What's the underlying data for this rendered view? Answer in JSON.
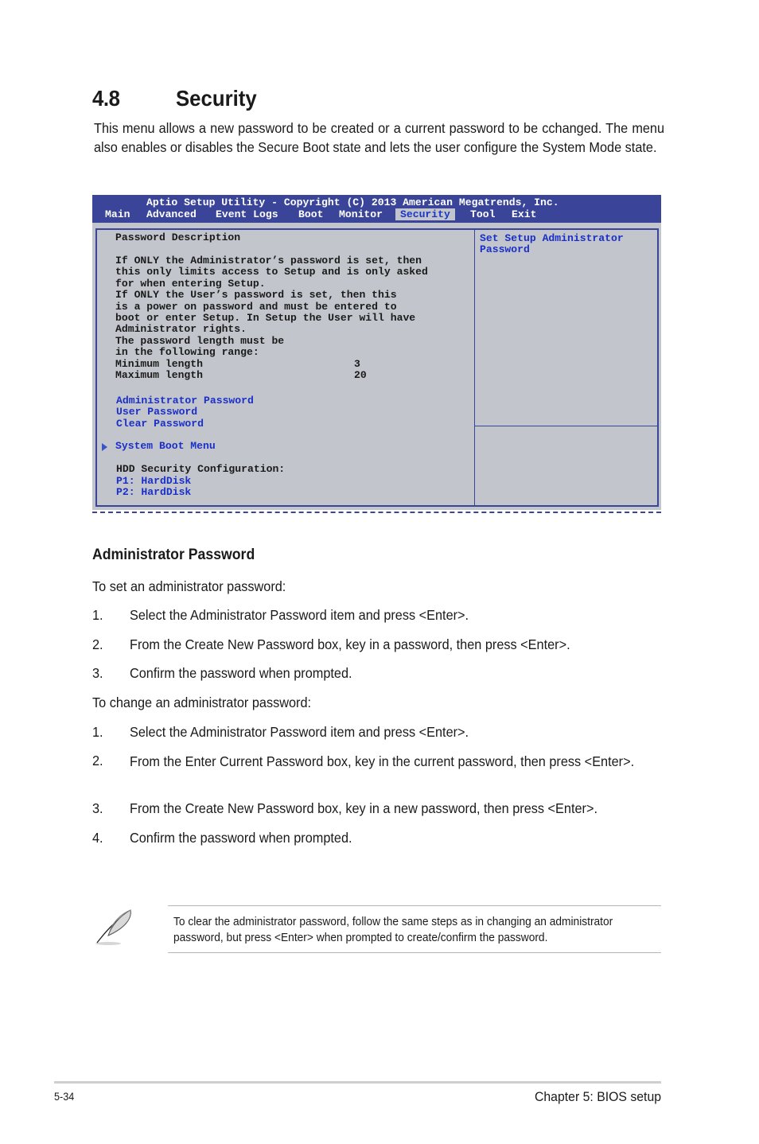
{
  "section": {
    "number": "4.8",
    "title": "Security",
    "intro": "This menu allows a new password to be created or a current password to be cchanged. The menu also enables or disables the Secure Boot state and lets the user configure the System Mode state."
  },
  "bios": {
    "title": "Aptio Setup Utility - Copyright (C) 2013 American Megatrends, Inc.",
    "tabs": [
      {
        "label": "Main",
        "active": false
      },
      {
        "label": "Advanced",
        "active": false
      },
      {
        "label": "Event Logs",
        "active": false
      },
      {
        "label": "Boot",
        "active": false
      },
      {
        "label": "Monitor",
        "active": false
      },
      {
        "label": "Security",
        "active": true
      },
      {
        "label": "Tool",
        "active": false
      },
      {
        "label": "Exit",
        "active": false
      }
    ],
    "description_heading": "Password Description",
    "description_lines": [
      "If ONLY the Administrator’s password is set, then",
      "this only limits access to Setup and is only asked",
      "for when entering Setup.",
      "If ONLY the User’s password is set, then this",
      "is a power on password and must be entered to",
      "boot or enter Setup. In Setup the User will have",
      "Administrator rights.",
      "The password length must be",
      "in the following range:"
    ],
    "min_length_label": "Minimum length",
    "min_length_value": "3",
    "max_length_label": "Maximum length",
    "max_length_value": "20",
    "items": [
      {
        "label": "Administrator Password"
      },
      {
        "label": "User Password"
      },
      {
        "label": "Clear Password"
      }
    ],
    "submenu": "System Boot Menu",
    "hdd_heading": "HDD Security Configuration:",
    "hdd_items": [
      {
        "label": "P1: HardDisk"
      },
      {
        "label": "P2: HardDisk"
      }
    ],
    "help_line1": "Set Setup Administrator",
    "help_line2": "Password",
    "colors": {
      "header_bg": "#3a4599",
      "panel_bg": "#c2c5cb",
      "item_text": "#1a2fc9"
    }
  },
  "admin": {
    "heading": "Administrator Password",
    "set_intro": "To set an administrator password:",
    "set_steps": [
      {
        "num": "1.",
        "text": "Select the Administrator Password item and press <Enter>."
      },
      {
        "num": "2.",
        "text": "From the Create New Password box, key in a password, then press <Enter>."
      },
      {
        "num": "3.",
        "text": "Confirm the password when prompted."
      }
    ],
    "change_intro": "To change an administrator password:",
    "change_steps": [
      {
        "num": "1.",
        "text": "Select the Administrator Password item and press <Enter>."
      },
      {
        "num": "2.",
        "text": "From the Enter Current Password box, key in the current password, then press <Enter>."
      },
      {
        "num": "3.",
        "text": "From the Create New Password box, key in a new password, then press <Enter>."
      },
      {
        "num": "4.",
        "text": "Confirm the password when prompted."
      }
    ]
  },
  "note": {
    "icon": "feather-pen-icon",
    "text": "To clear the administrator password, follow the same steps as in changing an administrator password, but press <Enter> when prompted to create/confirm the password."
  },
  "footer": {
    "page": "5-34",
    "chapter": "Chapter 5: BIOS setup"
  }
}
